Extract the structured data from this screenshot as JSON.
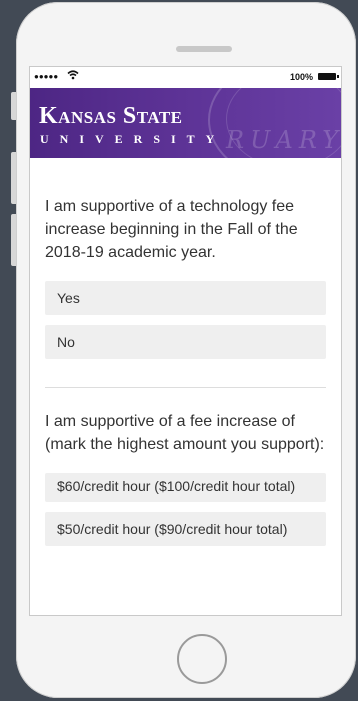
{
  "status_bar": {
    "signal_dots": "●●●●●",
    "wifi_icon": "wifi-icon",
    "battery_percent": "100%"
  },
  "banner": {
    "title": "Kansas State",
    "subtitle": "UNIVERSITY",
    "watermark": "RUARY"
  },
  "questions": [
    {
      "text": "I am supportive of a technology fee increase beginning in the Fall of the 2018-19 academic year.",
      "options": [
        "Yes",
        "No"
      ]
    },
    {
      "text": "I am supportive of a fee increase of (mark the highest amount you support):",
      "options": [
        "$60/credit hour ($100/credit hour total)",
        "$50/credit hour ($90/credit hour total)"
      ]
    }
  ],
  "colors": {
    "background": "#424a55",
    "banner": "#512888",
    "option_bg": "#efefef"
  }
}
